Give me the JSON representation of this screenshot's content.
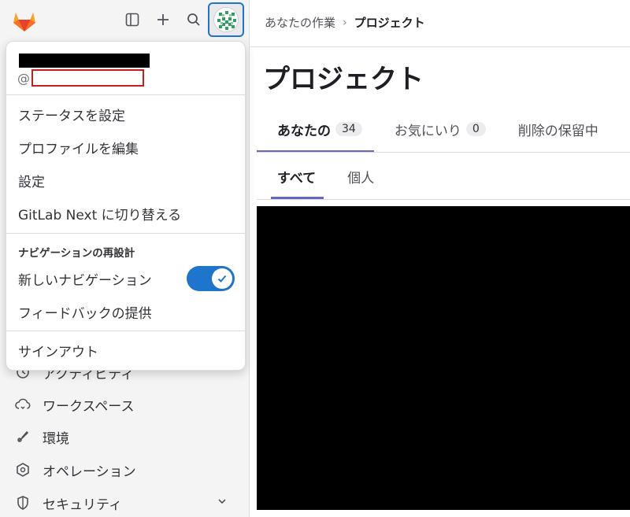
{
  "sidebar": {
    "top_icons": [
      "gitlab-logo",
      "sidebar-toggle-icon",
      "plus-icon",
      "search-icon"
    ],
    "nav_items": [
      {
        "label": "アクティビティ",
        "icon": "history-icon"
      },
      {
        "label": "ワークスペース",
        "icon": "cloud-icon"
      },
      {
        "label": "環境",
        "icon": "rocket-icon"
      },
      {
        "label": "オペレーション",
        "icon": "deployments-icon"
      },
      {
        "label": "セキュリティ",
        "icon": "shield-icon",
        "expandable": true
      }
    ]
  },
  "user_menu": {
    "handle_prefix": "@",
    "set_status": "ステータスを設定",
    "edit_profile": "プロファイルを編集",
    "preferences": "設定",
    "switch_next": "GitLab Next に切り替える",
    "nav_redesign_heading": "ナビゲーションの再設計",
    "new_navigation": "新しいナビゲーション",
    "new_navigation_enabled": true,
    "feedback": "フィードバックの提供",
    "sign_out": "サインアウト"
  },
  "breadcrumb": {
    "parent": "あなたの作業",
    "separator": "›",
    "current": "プロジェクト"
  },
  "page": {
    "title": "プロジェクト"
  },
  "tabs": [
    {
      "label": "あなたの",
      "count": "34",
      "active": true
    },
    {
      "label": "お気にいり",
      "count": "0",
      "active": false
    },
    {
      "label": "削除の保留中",
      "count": "",
      "active": false
    }
  ],
  "subtabs": [
    {
      "label": "すべて",
      "active": true
    },
    {
      "label": "個人",
      "active": false
    }
  ],
  "colors": {
    "accent": "#1f75cb",
    "tab_underline": "#6666c4",
    "redaction_border": "#c91c1c"
  }
}
